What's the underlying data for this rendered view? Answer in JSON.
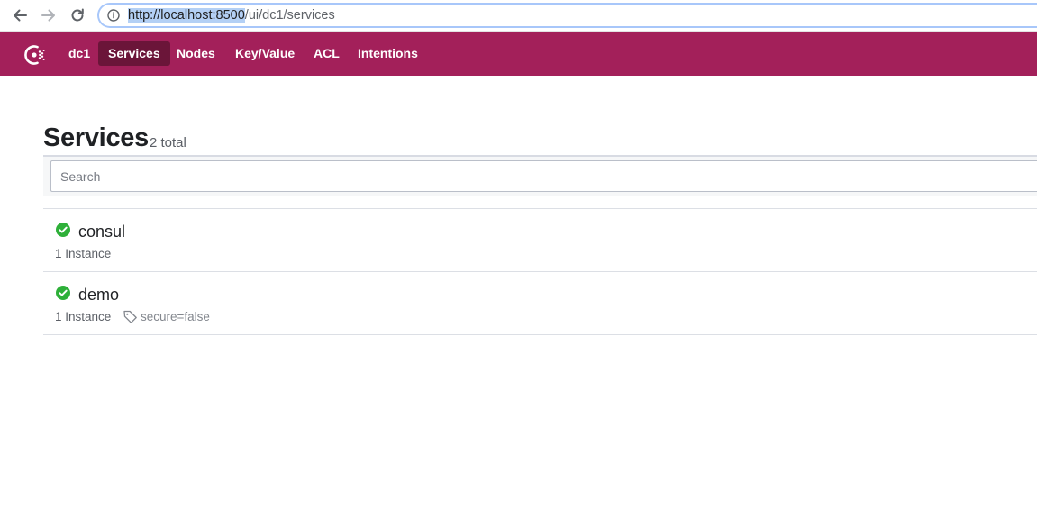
{
  "browser": {
    "url_selected": "http://localhost:8500",
    "url_rest": "/ui/dc1/services",
    "icons": [
      "back-arrow-icon",
      "forward-arrow-icon",
      "reload-icon",
      "info-icon"
    ]
  },
  "header": {
    "logo": "consul-logo",
    "datacenter": "dc1",
    "nav": [
      "Services",
      "Nodes",
      "Key/Value",
      "ACL",
      "Intentions"
    ],
    "active": "Services",
    "color": "#a3205a",
    "active_color": "#6b1539"
  },
  "main": {
    "title": "Services",
    "count": "2 total",
    "search_placeholder": "Search",
    "services": [
      {
        "name": "consul",
        "status": "passing",
        "instances": "1 Instance",
        "tag": ""
      },
      {
        "name": "demo",
        "status": "passing",
        "instances": "1 Instance",
        "tag": "secure=false"
      }
    ],
    "passing_color": "#2eb039"
  }
}
